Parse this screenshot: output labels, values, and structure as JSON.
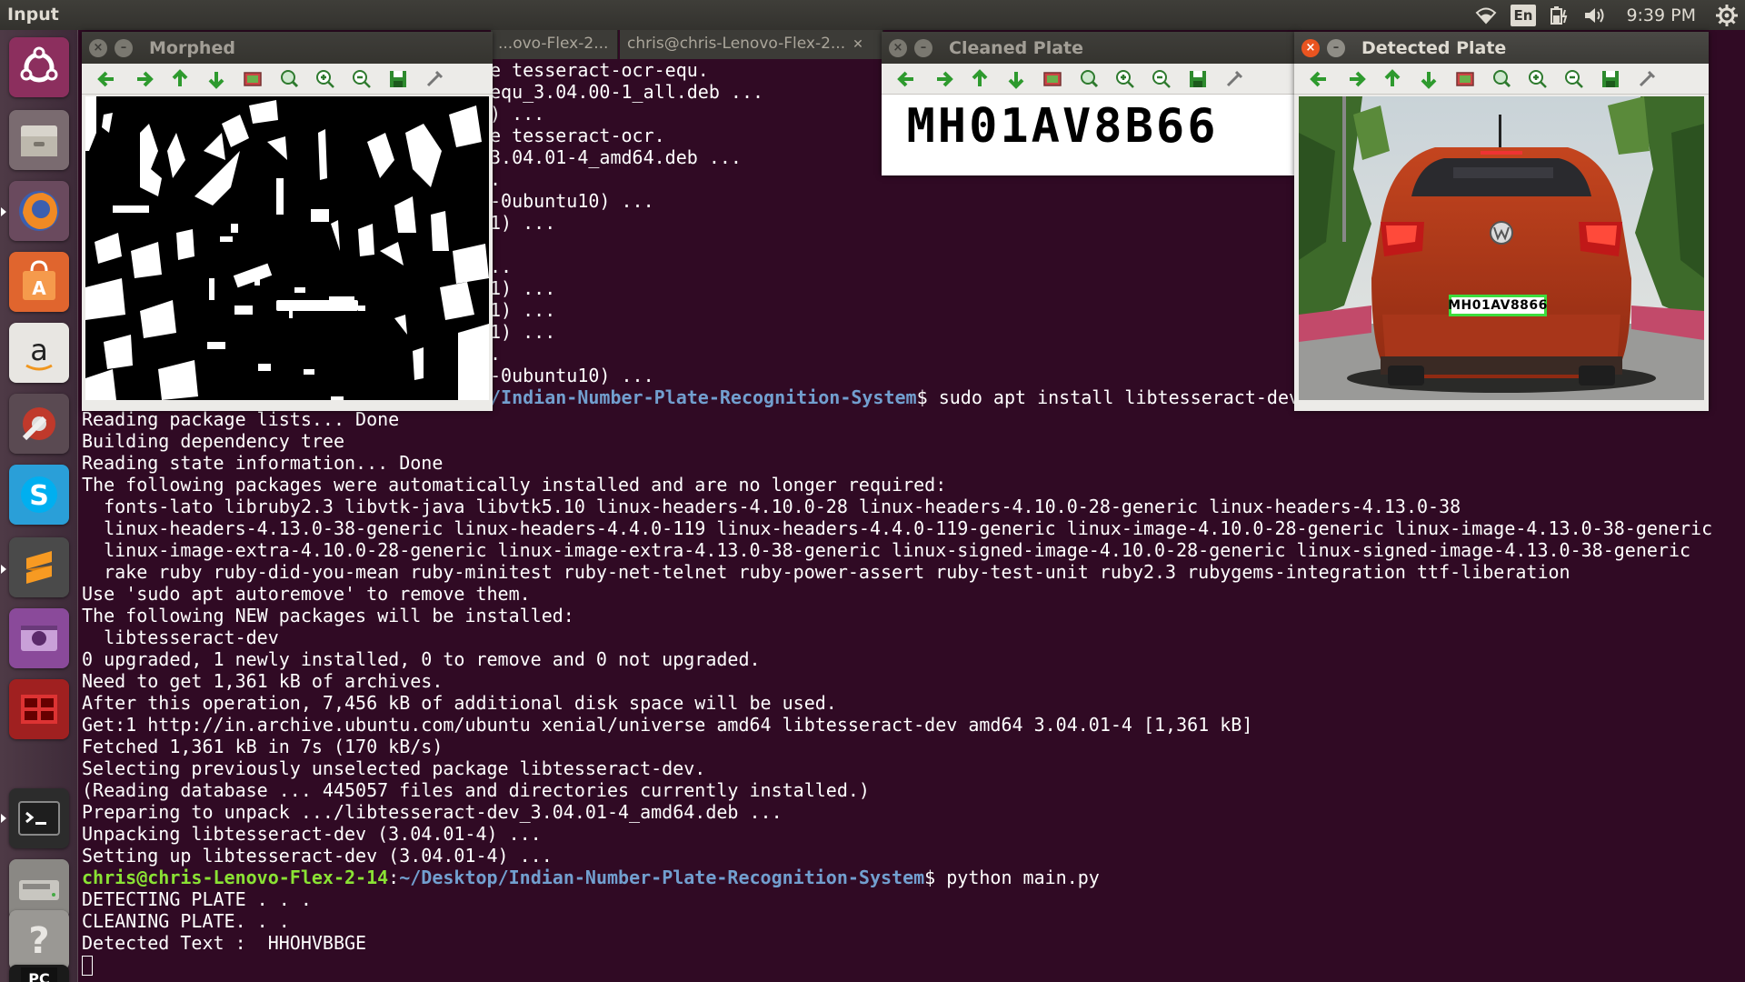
{
  "top_panel": {
    "app_title": "Input",
    "keyboard_layout": "En",
    "clock": "9:39 PM",
    "icons": [
      "wifi-icon",
      "keyboard-layout-indicator",
      "battery-icon",
      "volume-icon",
      "gear-icon"
    ]
  },
  "launcher": {
    "items": [
      "ubuntu-dash",
      "files",
      "firefox",
      "ubuntu-software",
      "amazon",
      "system-settings",
      "skype",
      "sublime-text",
      "screen-recorder",
      "video-editor",
      "terminal",
      "disk-drive",
      "help",
      "pycharm"
    ]
  },
  "terminal": {
    "tabs": [
      "...ovo-Flex-2...",
      "chris@chris-Lenovo-Flex-2..."
    ],
    "prompt_user": "chris@chris-Lenovo-Flex-2-14",
    "prompt_path": "~/Desktop/Indian-Number-Plate-Recognition-System",
    "prompt_symbol": "$",
    "partial_lines": [
      "e tesseract-ocr-equ.",
      "equ_3.04.00-1_all.deb ...",
      ") ...",
      "e tesseract-ocr.",
      "3.04.01-4_amd64.deb ...",
      ".",
      "-0ubuntu10) ...",
      "1) ...",
      "",
      "..",
      "1) ...",
      "1) ...",
      "1) ...",
      ".",
      "-0ubuntu10) ..."
    ],
    "partial_prompt_path": "/Indian-Number-Plate-Recognition-System",
    "command_install": "sudo apt install libtesseract-dev",
    "output_lines": [
      "Reading package lists... Done",
      "Building dependency tree",
      "Reading state information... Done",
      "The following packages were automatically installed and are no longer required:",
      "  fonts-lato libruby2.3 libvtk-java libvtk5.10 linux-headers-4.10.0-28 linux-headers-4.10.0-28-generic linux-headers-4.13.0-38",
      "  linux-headers-4.13.0-38-generic linux-headers-4.4.0-119 linux-headers-4.4.0-119-generic linux-image-4.10.0-28-generic linux-image-4.13.0-38-generic",
      "  linux-image-extra-4.10.0-28-generic linux-image-extra-4.13.0-38-generic linux-signed-image-4.10.0-28-generic linux-signed-image-4.13.0-38-generic",
      "  rake ruby ruby-did-you-mean ruby-minitest ruby-net-telnet ruby-power-assert ruby-test-unit ruby2.3 rubygems-integration ttf-liberation",
      "Use 'sudo apt autoremove' to remove them.",
      "The following NEW packages will be installed:",
      "  libtesseract-dev",
      "0 upgraded, 1 newly installed, 0 to remove and 0 not upgraded.",
      "Need to get 1,361 kB of archives.",
      "After this operation, 7,456 kB of additional disk space will be used.",
      "Get:1 http://in.archive.ubuntu.com/ubuntu xenial/universe amd64 libtesseract-dev amd64 3.04.01-4 [1,361 kB]",
      "Fetched 1,361 kB in 7s (170 kB/s)",
      "Selecting previously unselected package libtesseract-dev.",
      "(Reading database ... 445057 files and directories currently installed.)",
      "Preparing to unpack .../libtesseract-dev_3.04.01-4_amd64.deb ...",
      "Unpacking libtesseract-dev (3.04.01-4) ...",
      "Setting up libtesseract-dev (3.04.01-4) ..."
    ],
    "command_run": "python main.py",
    "run_output": [
      "DETECTING PLATE . . .",
      "CLEANING PLATE. . .",
      "Detected Text :  HHOHVBBGE"
    ]
  },
  "windows": {
    "morphed": {
      "title": "Morphed"
    },
    "cleaned": {
      "title": "Cleaned Plate",
      "plate_text": "MH01AV8B66"
    },
    "detected": {
      "title": "Detected Plate",
      "plate_text": "MH01AV8866"
    }
  },
  "colors": {
    "terminal_bg": "#300a24",
    "prompt_user": "#8ae234",
    "prompt_path": "#729fcf",
    "detection_box": "#3ddc3d",
    "close_active": "#e95420"
  }
}
